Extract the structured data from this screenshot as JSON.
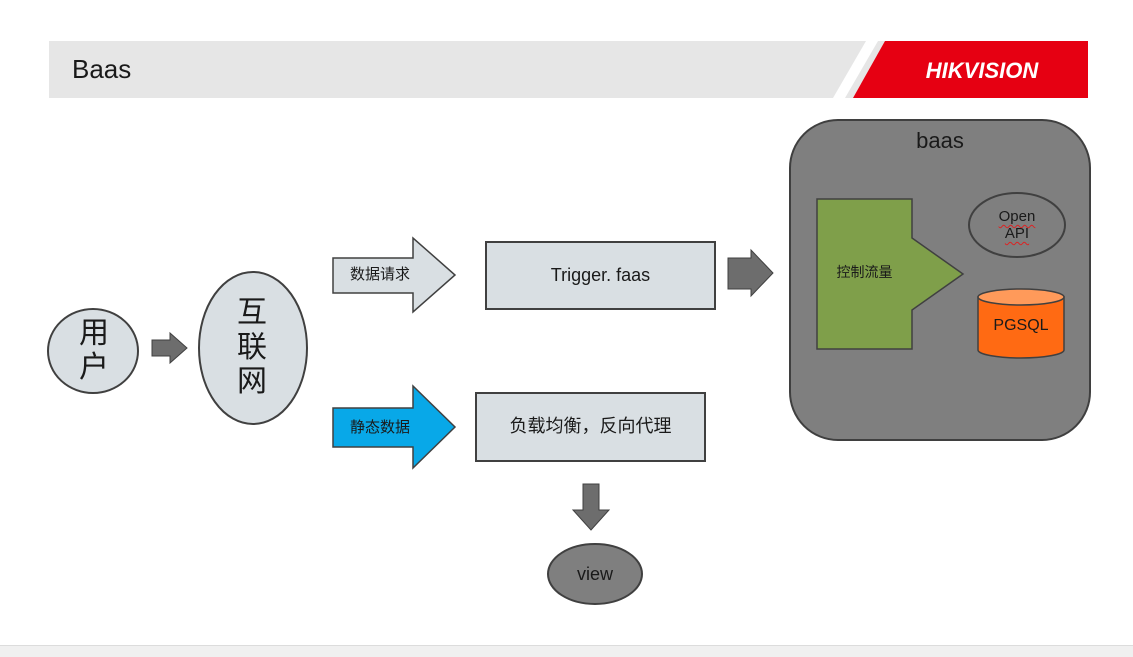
{
  "header": {
    "title": "Baas",
    "logo_text": "HIKVISION"
  },
  "nodes": {
    "user": "用户",
    "internet": "互联网",
    "data_request": "数据请求",
    "static_data": "静态数据",
    "trigger": "Trigger. faas",
    "load_balance": "负载均衡，反向代理",
    "view": "view",
    "baas_title": "baas",
    "control_flow": "控制流量",
    "open_api": "Open API",
    "pgsql": "PGSQL"
  },
  "colors": {
    "brand_red": "#e60012",
    "node_gray": "#d9dfe3",
    "baas_container": "#7f7f7f",
    "control_green": "#7f9f4a",
    "pgsql_orange": "#ff6a13",
    "static_blue": "#08a8e8",
    "arrow_gray": "#6d6d6d"
  }
}
